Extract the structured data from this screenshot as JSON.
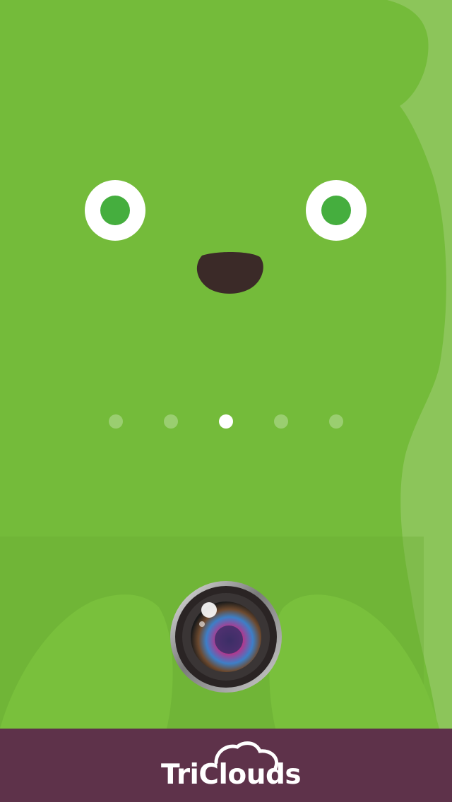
{
  "colors": {
    "body_green": "#74bb3a",
    "body_shadow_green": "#6aad35",
    "side_light_green": "#8cc55a",
    "eye_white": "#ffffff",
    "pupil_green": "#45ae3e",
    "nose_dark": "#3b2a28",
    "footer_plum": "#5e324a"
  },
  "pager": {
    "count": 5,
    "active_index": 2
  },
  "camera": {
    "icon": "camera-lens-icon"
  },
  "footer": {
    "logo_icon": "cloud-icon",
    "brand_name": "TriClouds"
  }
}
